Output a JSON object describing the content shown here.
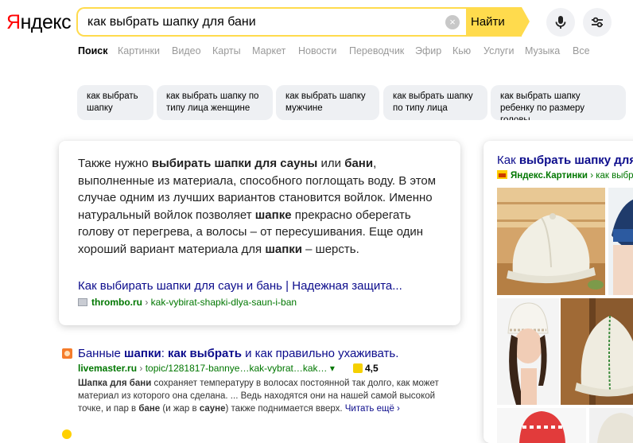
{
  "logo": {
    "first_letter": "Я",
    "rest": "ндекс"
  },
  "search": {
    "query": "как выбрать шапку для бани",
    "clear_label": "×",
    "button_label": "Найти"
  },
  "tabs": [
    "Поиск",
    "Картинки",
    "Видео",
    "Карты",
    "Маркет",
    "Новости",
    "Переводчик",
    "Эфир",
    "Кью",
    "Услуги",
    "Музыка",
    "Все"
  ],
  "suggestions": [
    "как выбрать шапку",
    "как выбрать шапку по типу лица женщине",
    "как выбрать шапку мужчине",
    "как выбрать шапку по типу лица",
    "как выбрать шапку ребенку по размеру головы"
  ],
  "snippet": {
    "parts": [
      {
        "t": "Также нужно ",
        "b": false
      },
      {
        "t": "выбирать шапки для сауны",
        "b": true
      },
      {
        "t": " или ",
        "b": false
      },
      {
        "t": "бани",
        "b": true
      },
      {
        "t": ", выполненные из материала, способного поглощать воду. В этом случае одним из лучших вариантов становится войлок. Именно натуральный войлок позволяет ",
        "b": false
      },
      {
        "t": "шапке",
        "b": true
      },
      {
        "t": " прекрасно оберегать голову от перегрева, а волосы – от пересушивания. Еще один хороший вариант материала для ",
        "b": false
      },
      {
        "t": "шапки",
        "b": true
      },
      {
        "t": " – шерсть.",
        "b": false
      }
    ],
    "link": "Как выбирать шапки для саун и бань | Надежная защита...",
    "source_domain": "thrombo.ru",
    "source_sep": " › ",
    "source_path": "kak-vybirat-shapki-dlya-saun-i-ban"
  },
  "result": {
    "title_parts": [
      {
        "t": "Банные ",
        "b": false
      },
      {
        "t": "шапки",
        "b": true
      },
      {
        "t": ": ",
        "b": false
      },
      {
        "t": "как выбрать",
        "b": true
      },
      {
        "t": " и как правильно ухаживать.",
        "b": false
      }
    ],
    "url_domain": "livemaster.ru",
    "url_sep": " › ",
    "url_path": "topic/1281817-bannye…kak-vybrat…kak… ▾",
    "rating": "4,5",
    "text_parts": [
      {
        "t": "Шапка для бани",
        "b": true
      },
      {
        "t": " сохраняет температуру в волосах постоянной так долго, как может материал из которого она сделана. ... Ведь находятся они на нашей самой высокой точке, и пар в ",
        "b": false
      },
      {
        "t": "бане",
        "b": true
      },
      {
        "t": " (и жар в ",
        "b": false
      },
      {
        "t": "сауне",
        "b": true
      },
      {
        "t": ") также поднимается вверх. ",
        "b": false
      }
    ],
    "read_more": "Читать ещё ›"
  },
  "images": {
    "title_plain": "Как ",
    "title_bold": "выбрать шапку для бани",
    "source_name": "Яндекс.Картинки",
    "source_rest": " › как выбрать шапку"
  },
  "colors": {
    "accent_yellow": "#ffdb4d",
    "link_blue": "#0c0c8c",
    "url_green": "#007700"
  }
}
